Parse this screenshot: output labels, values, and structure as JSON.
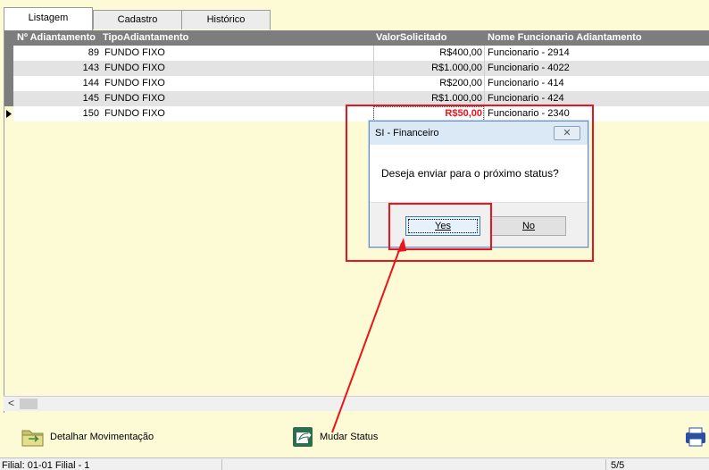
{
  "tabs": [
    {
      "label": "Listagem",
      "active": true
    },
    {
      "label": "Cadastro",
      "active": false
    },
    {
      "label": "Histórico",
      "active": false
    }
  ],
  "grid": {
    "columns": [
      "Nº Adiantamento",
      "TipoAdiantamento",
      "ValorSolicitado",
      "Nome Funcionario Adiantamento"
    ],
    "rows": [
      {
        "id": "89",
        "tipo": "FUNDO FIXO",
        "valor": "R$400,00",
        "nome": "Funcionario - 2914"
      },
      {
        "id": "143",
        "tipo": "FUNDO FIXO",
        "valor": "R$1.000,00",
        "nome": "Funcionario - 4022"
      },
      {
        "id": "144",
        "tipo": "FUNDO FIXO",
        "valor": "R$200,00",
        "nome": "Funcionario - 414"
      },
      {
        "id": "145",
        "tipo": "FUNDO FIXO",
        "valor": "R$1.000,00",
        "nome": "Funcionario - 424"
      },
      {
        "id": "150",
        "tipo": "FUNDO FIXO",
        "valor": "R$50,00",
        "nome": "Funcionario - 2340"
      }
    ],
    "selected_row": 4,
    "highlight_color": "#e8151c"
  },
  "scroll": {
    "left_arrow": "<"
  },
  "toolbar": {
    "detalhar_label": "Detalhar Movimentação",
    "mudar_label": "Mudar Status"
  },
  "statusbar": {
    "filial": "Filial: 01-01 Filial - 1",
    "count": "5/5"
  },
  "dialog": {
    "title": "SI - Financeiro",
    "close": "✕",
    "message": "Deseja enviar para o próximo status?",
    "yes_label": "Yes",
    "no_label": "No"
  },
  "colors": {
    "background": "#fdfbd6",
    "header": "#7d7d7d",
    "annotation": "#e8151c"
  }
}
